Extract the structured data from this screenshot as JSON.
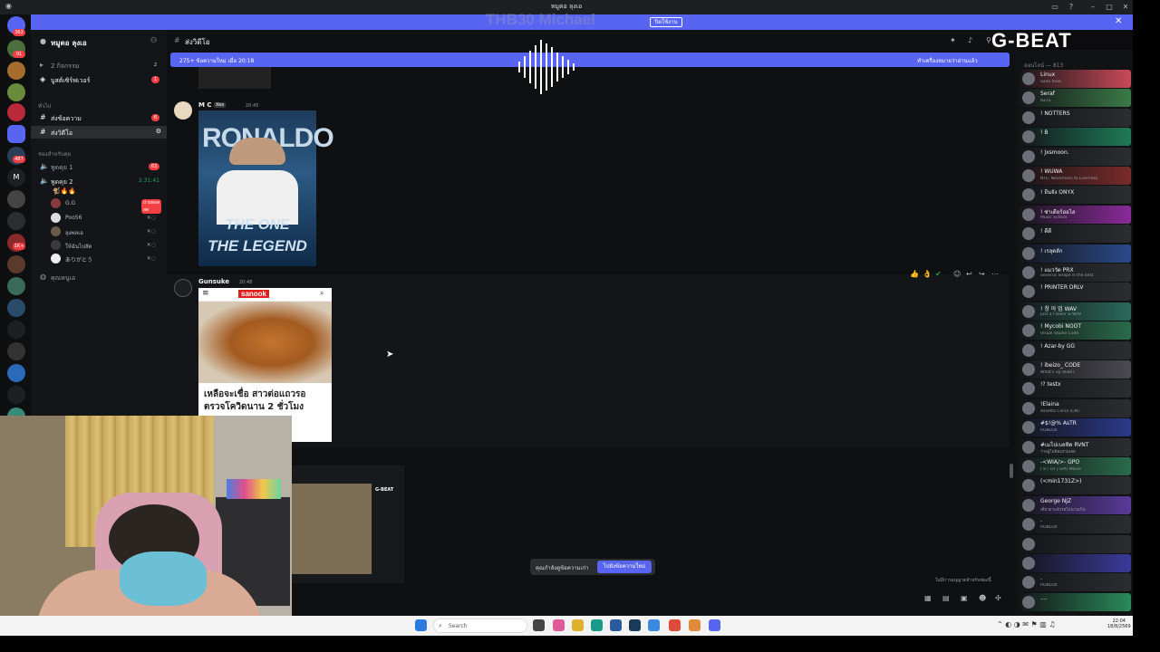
{
  "window": {
    "title": "หมูตอ ลุงเอ"
  },
  "notice": {
    "text": "THB30 Michael",
    "button": "ปิดใช้งาน"
  },
  "server_rail": {
    "badges": [
      "362",
      "91",
      "487",
      "1K+"
    ]
  },
  "guild": {
    "name": "หมูตอ ลุงเอ"
  },
  "sidebar": {
    "events": "2 กิจกรรม",
    "events_count": "2",
    "boost": "บูสต์เซิร์ฟเวอร์",
    "boost_count": "1",
    "cat_general": "ทั่วไป",
    "channels": [
      {
        "name": "ส่งข้อความ",
        "badge": "6"
      },
      {
        "name": "ส่งวิดีโอ",
        "badge": ""
      }
    ],
    "cat_voice": "ช่องสำหรับคุย",
    "voice1": "พูดคุย 1",
    "voice1_badge": "63",
    "voice2": "พูดคุย 2",
    "voice2_time": "2:31:41",
    "live_badge": "ถ่ายทอดสด",
    "voice_users": [
      "G.G",
      "Poo56",
      "ลุงพลเอ",
      "ให้ฉันไปสัด",
      "ありがとう"
    ],
    "stage": "คุณหนูเอ"
  },
  "channel": {
    "name": "ส่งวิดีโอ"
  },
  "new_bar": {
    "left": "275+ ข้อความใหม่ เมื่อ 20:18",
    "right": "ทำเครื่องหมายว่าอ่านแล้ว"
  },
  "messages": [
    {
      "author": "M C",
      "tag": "Xex",
      "time": "20:45",
      "image": {
        "title": "RONALDO",
        "line1": "THE ONE",
        "line2": "THE LEGEND"
      }
    },
    {
      "author": "Gunsuke",
      "time": "20:48",
      "embed": {
        "site": "sanook",
        "headline": "เหลือจะเชื่อ สาวต่อแถวรอ ตรวจโควิดนาน 2 ชั่วโมง"
      }
    }
  ],
  "jump": {
    "label": "คุณกำลังดูข้อความเก่า",
    "button": "ไปยังข้อความใหม่"
  },
  "composer": {
    "hint": "ไม่มีการอนุญาตสำหรับช่องนี้"
  },
  "members": {
    "header": "ออนไลน์ — 813",
    "list": [
      {
        "name": "Linux",
        "status": "SaaS tools",
        "color": "#c84a58"
      },
      {
        "name": "Seraf",
        "status": "IELTS",
        "color": "#3a7a46"
      },
      {
        "name": "! NOTTERS",
        "status": "",
        "color": "#2b2d31"
      },
      {
        "name": "! B",
        "status": "",
        "color": "#1e7a58"
      },
      {
        "name": "! Jxsmoon.",
        "status": "",
        "color": "#2b2d31"
      },
      {
        "name": "! WUWA",
        "status": "NTE: Neverness to Everness",
        "color": "#7a2a2a"
      },
      {
        "name": "! ยีนจัง ONYX",
        "status": "",
        "color": "#2b2d31"
      },
      {
        "name": "! ซ่าเดียร์ฮอไล",
        "status": "Music School",
        "color": "#8a2a9a"
      },
      {
        "name": "! ดีดี",
        "status": "",
        "color": "#2b2d31"
      },
      {
        "name": "! เรลุดลัก",
        "status": "",
        "color": "#2b4a8a"
      },
      {
        "name": "! แมววัด PRX",
        "status": "Severus Snape is the best",
        "color": "#2b2d31"
      },
      {
        "name": "! PRINTER DRLV",
        "status": "",
        "color": "#2b2d31"
      },
      {
        "name": "! 창 아 엄 WAV",
        "status": "Just a Flower & WAV",
        "color": "#2a6a5a"
      },
      {
        "name": "! Mycobi NOOT",
        "status": "Visual Studio Code",
        "color": "#2a6a4a"
      },
      {
        "name": "! Azar-by GG",
        "status": "",
        "color": "#2b2d31"
      },
      {
        "name": "! ibeizo_ CODE",
        "status": "What's up dude?",
        "color": "#4a4a50"
      },
      {
        "name": "!? testx",
        "status": "",
        "color": "#2b2d31"
      },
      {
        "name": "!Elaina",
        "status": "Assetto Corsa (CM)",
        "color": "#2b2d31"
      },
      {
        "name": "#$!@% AsTR",
        "status": "ROBLOX",
        "color": "#2a3a8a"
      },
      {
        "name": "#เมโปเบลหิด RVNT",
        "status": "ว่าอยู่ไม่ต้องถามเลย",
        "color": "#2b2d31"
      },
      {
        "name": "-<WIA/>- GPO",
        "status": "[ 8 / 10 ] GPU Movie",
        "color": "#2a6a4a"
      },
      {
        "name": "(<min1731Z>)",
        "status": "",
        "color": "#2b2d31"
      },
      {
        "name": "George NJZ",
        "status": "เดี๋ยวมาแล้วรอไม่นานเกิน",
        "color": "#5a3a9a"
      },
      {
        "name": ".",
        "status": "ROBLOX",
        "color": "#2b2d31"
      },
      {
        "name": "",
        "status": "",
        "color": "#2b2d31"
      },
      {
        "name": "",
        "status": "",
        "color": "#3a3a9a"
      },
      {
        "name": ".",
        "status": "ROBLOX",
        "color": "#2b2d31"
      },
      {
        "name": "....",
        "status": "",
        "color": "#2a8a5a"
      }
    ]
  },
  "brand": {
    "name": "G-BEAT"
  },
  "taskbar": {
    "search": "Search",
    "time": "22:04",
    "date": "18/8/2569"
  },
  "colors": {
    "accent": "#5865f2",
    "bg": "#0f1012",
    "danger": "#f23f43"
  }
}
